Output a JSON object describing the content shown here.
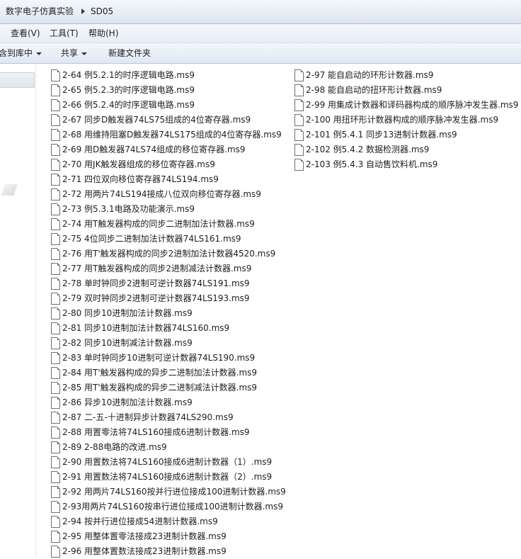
{
  "address": {
    "crumbs": [
      "数字电子仿真实验",
      "SD05"
    ]
  },
  "menu": {
    "items": [
      "查看(V)",
      "工具(T)",
      "帮助(H)"
    ]
  },
  "toolbar": {
    "library_label": "包含到库中",
    "share_label": "共享",
    "new_folder_label": "新建文件夹"
  },
  "files": [
    "2-64 例5.2.1的时序逻辑电路.ms9",
    "2-65 例5.2.3的时序逻辑电路.ms9",
    "2-66 例5.2.4的时序逻辑电路.ms9",
    "2-67 同步D触发器74LS75组成的4位寄存器.ms9",
    "2-68 用维持阻塞D触发器74LS175组成的4位寄存器.ms9",
    "2-69 用D触发器74LS74组成的移位寄存器.ms9",
    "2-70 用JK触发器组成的移位寄存器.ms9",
    "2-71 四位双向移位寄存器74LS194.ms9",
    "2-72 用两片74LS194接成八位双向移位寄存器.ms9",
    "2-73 例5.3.1电路及功能演示.ms9",
    "2-74 用T触发器构成的同步二进制加法计数器.ms9",
    "2-75 4位同步二进制加法计数器74LS161.ms9",
    "2-76 用T'触发器构成的同步2进制加法计数器4520.ms9",
    "2-77 用T触发器构成的同步2进制减法计数器.ms9",
    "2-78 单时钟同步2进制可逆计数器74LS191.ms9",
    "2-79 双时钟同步2进制可逆计数器74LS193.ms9",
    "2-80 同步10进制加法计数器.ms9",
    "2-81 同步10进制加法计数器74LS160.ms9",
    "2-82 同步10进制减法计数器.ms9",
    "2-83 单时钟同步10进制可逆计数器74LS190.ms9",
    "2-84 用T'触发器构成的异步二进制加法计数器.ms9",
    "2-85 用T'触发器构成的异步二进制减法计数器.ms9",
    "2-86 异步10进制加法计数器.ms9",
    "2-87 二-五-十进制异步计数器74LS290.ms9",
    "2-88 用置零法将74LS160接成6进制计数器.ms9",
    "2-89  2-88电路的改进.ms9",
    "2-90 用置数法将74LS160接成6进制计数器（1）.ms9",
    "2-91 用置数法将74LS160接成6进制计数器（2）.ms9",
    "2-92 用两片74LS160按并行进位接成100进制计数器.ms9",
    "2-93用两片74LS160按串行进位接成100进制计数器.ms9",
    "2-94 按并行进位接成54进制计数器.ms9",
    "2-95 用整体置零法接成23进制计数器.ms9",
    "2-96 用整体置数法接成23进制计数器.ms9",
    "2-97 能自启动的环形计数器.ms9",
    "2-98 能自启动的扭环形计数器.ms9",
    "2-99 用集成计数器和译码器构成的顺序脉冲发生器.ms9",
    "2-100 用扭环形计数器构成的顺序脉冲发生器.ms9",
    "2-101 例5.4.1 同步13进制计数器.ms9",
    "2-102 例5.4.2 数据检测器.ms9",
    "2-103 例5.4.3 自动售饮料机.ms9"
  ]
}
